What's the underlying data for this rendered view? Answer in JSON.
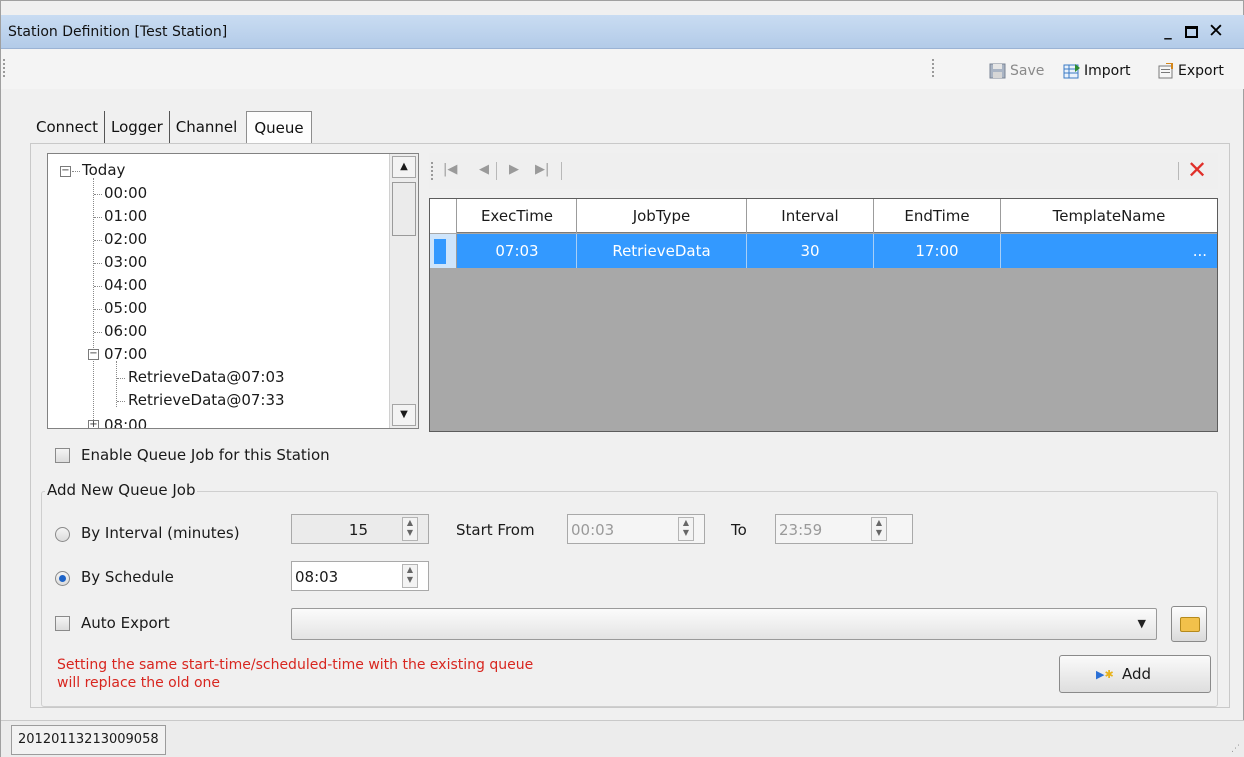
{
  "window": {
    "title": "Station Definition  [Test Station]",
    "min_label": "_",
    "close_label": "✕"
  },
  "toolbar": {
    "save_label": "Save",
    "import_label": "Import",
    "export_label": "Export"
  },
  "tabs": [
    {
      "label": "Connect",
      "active": false
    },
    {
      "label": "Logger",
      "active": false
    },
    {
      "label": "Channel",
      "active": false
    },
    {
      "label": "Queue",
      "active": true
    }
  ],
  "tree": {
    "root": "Today",
    "hours": [
      "00:00",
      "01:00",
      "02:00",
      "03:00",
      "04:00",
      "05:00",
      "06:00",
      "07:00"
    ],
    "children_0700": [
      "RetrieveData@07:03",
      "RetrieveData@07:33"
    ],
    "partial_item": "08:00"
  },
  "grid": {
    "columns": [
      "ExecTime",
      "JobType",
      "Interval",
      "EndTime",
      "TemplateName"
    ],
    "rows": [
      {
        "ExecTime": "07:03",
        "JobType": "RetrieveData",
        "Interval": "30",
        "EndTime": "17:00",
        "TemplateName": "...",
        "selected": true
      }
    ]
  },
  "navigator": {
    "first_icon": "first-record-icon",
    "prev_icon": "previous-record-icon",
    "next_icon": "next-record-icon",
    "last_icon": "last-record-icon",
    "delete_icon": "delete-icon"
  },
  "queue": {
    "enable_label": "Enable Queue Job for this Station",
    "enable_checked": false,
    "group_title": "Add New Queue Job",
    "by_interval_label": "By Interval (minutes)",
    "by_interval_selected": false,
    "interval_value": "15",
    "start_from_label": "Start From",
    "start_from_value": "00:03",
    "to_label": "To",
    "to_value": "23:59",
    "by_schedule_label": "By Schedule",
    "by_schedule_selected": true,
    "schedule_value": "08:03",
    "auto_export_label": "Auto Export",
    "auto_export_checked": false,
    "auto_export_value": "",
    "warning_line1": "Setting the same start-time/scheduled-time with the existing queue",
    "warning_line2": "will replace the old one",
    "add_label": "Add"
  },
  "status": {
    "id": "20120113213009058"
  },
  "colors": {
    "selection": "#3399ff",
    "warning_text": "#d8261f",
    "delete_red": "#e0302a",
    "titlebar": "#b3cbe8"
  }
}
